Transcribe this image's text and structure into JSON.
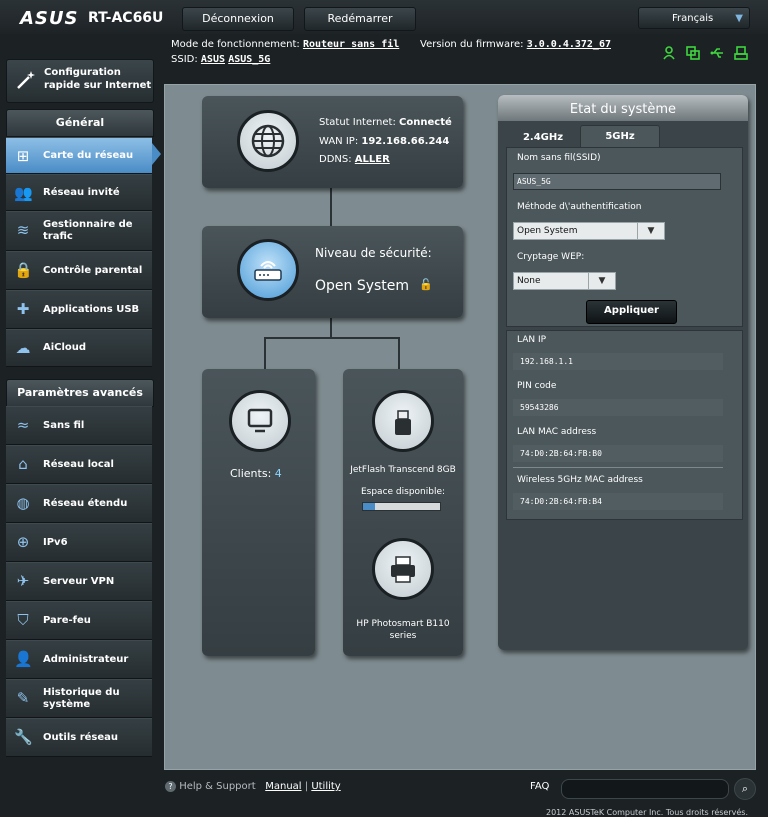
{
  "header": {
    "logo": "ASUS",
    "model": "RT-AC66U",
    "logout_label": "Déconnexion",
    "reboot_label": "Redémarrer",
    "language": "Français",
    "mode_label": "Mode de fonctionnement:",
    "mode_value": "Routeur sans fil",
    "firmware_label": "Version du firmware:",
    "firmware_value": "3.0.0.4.372_67",
    "ssid_label": "SSID:",
    "ssid_1": "ASUS",
    "ssid_2": "ASUS_5G",
    "status_icons": [
      "user-status-icon",
      "copy-status-icon",
      "usb-status-icon",
      "printer-status-icon"
    ]
  },
  "sidebar": {
    "quick_setup": "Configuration rapide sur Internet",
    "general_header": "Général",
    "general_items": [
      {
        "label": "Carte du réseau",
        "icon": "network-map-icon"
      },
      {
        "label": "Réseau invité",
        "icon": "guest-icon"
      },
      {
        "label": "Gestionnaire de trafic",
        "icon": "traffic-icon"
      },
      {
        "label": "Contrôle parental",
        "icon": "lock-icon"
      },
      {
        "label": "Applications USB",
        "icon": "puzzle-icon"
      },
      {
        "label": "AiCloud",
        "icon": "cloud-icon"
      }
    ],
    "advanced_header": "Paramètres avancés",
    "advanced_items": [
      {
        "label": "Sans fil",
        "icon": "wifi-icon"
      },
      {
        "label": "Réseau local",
        "icon": "home-icon"
      },
      {
        "label": "Réseau étendu",
        "icon": "globe-icon"
      },
      {
        "label": "IPv6",
        "icon": "ipv6-icon"
      },
      {
        "label": "Serveur VPN",
        "icon": "vpn-icon"
      },
      {
        "label": "Pare-feu",
        "icon": "shield-icon"
      },
      {
        "label": "Administrateur",
        "icon": "admin-icon"
      },
      {
        "label": "Historique du système",
        "icon": "log-icon"
      },
      {
        "label": "Outils réseau",
        "icon": "tools-icon"
      }
    ]
  },
  "map": {
    "internet_status_label": "Statut Internet:",
    "internet_status_value": "Connecté",
    "wan_ip_label": "WAN IP:",
    "wan_ip_value": "192.168.66.244",
    "ddns_label": "DDNS:",
    "ddns_value": "ALLER",
    "security_label": "Niveau de sécurité:",
    "security_value": "Open System",
    "clients_label": "Clients:",
    "clients_count": "4",
    "usb_name": "JetFlash Transcend 8GB",
    "usb_space_label": "Espace disponible:",
    "usb_used_fraction": 0.15,
    "printer_name": "HP Photosmart B110 series"
  },
  "system_status": {
    "title": "Etat du système",
    "tab_24": "2.4GHz",
    "tab_5": "5GHz",
    "ssid_label": "Nom sans fil(SSID)",
    "ssid_value": "ASUS_5G",
    "auth_label": "Méthode d\\'authentification",
    "auth_value": "Open System",
    "wep_label": "Cryptage WEP:",
    "wep_value": "None",
    "apply_label": "Appliquer",
    "lan_ip_label": "LAN IP",
    "lan_ip_value": "192.168.1.1",
    "pin_label": "PIN code",
    "pin_value": "59543286",
    "lan_mac_label": "LAN MAC address",
    "lan_mac_value": "74:D0:2B:64:FB:B0",
    "wl_mac_label": "Wireless 5GHz MAC address",
    "wl_mac_value": "74:D0:2B:64:FB:B4"
  },
  "footer": {
    "help": "Help & Support",
    "manual": "Manual",
    "separator": "|",
    "utility": "Utility",
    "faq": "FAQ",
    "copyright": "2012 ASUSTeK Computer Inc. Tous droits réservés."
  },
  "colors": {
    "accent_blue": "#4a8cc6",
    "status_green": "#3fd53f"
  }
}
